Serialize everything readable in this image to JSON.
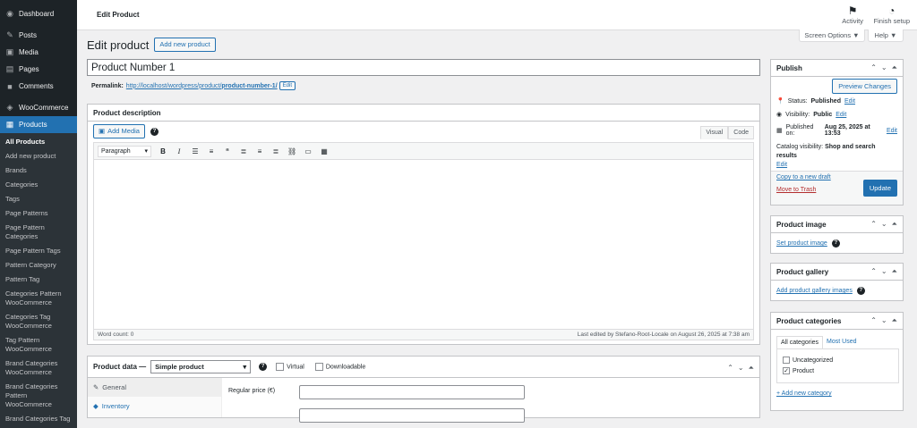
{
  "sidebar": {
    "items": [
      {
        "label": "Dashboard",
        "icon": "dashboard-icon",
        "glyph": "◉"
      },
      {
        "label": "Posts",
        "icon": "pin-icon",
        "glyph": "✎"
      },
      {
        "label": "Media",
        "icon": "media-icon",
        "glyph": "▣"
      },
      {
        "label": "Pages",
        "icon": "pages-icon",
        "glyph": "▤"
      },
      {
        "label": "Comments",
        "icon": "comments-icon",
        "glyph": "■"
      },
      {
        "label": "WooCommerce",
        "icon": "woocommerce-icon",
        "glyph": "◈"
      },
      {
        "label": "Products",
        "icon": "products-icon",
        "glyph": "▦"
      }
    ],
    "submenu": [
      "All Products",
      "Add new product",
      "Brands",
      "Categories",
      "Tags",
      "Page Patterns",
      "Page Pattern Categories",
      "Page Pattern Tags",
      "Pattern Category",
      "Pattern Tag",
      "Categories Pattern WooCommerce",
      "Categories Tag WooCommerce",
      "Tag Pattern WooCommerce",
      "Brand Categories WooCommerce",
      "Brand Categories Pattern WooCommerce",
      "Brand Categories Tag"
    ]
  },
  "topbar": {
    "title": "Edit Product",
    "activity": "Activity",
    "finish": "Finish setup",
    "screen_options": "Screen Options ▼",
    "help": "Help ▼"
  },
  "page": {
    "heading": "Edit product",
    "add_new": "Add new product",
    "product_title": "Product Number 1"
  },
  "permalink": {
    "label": "Permalink:",
    "url_base": "http://localhost/wordpress/product/",
    "slug": "product-number-1/",
    "edit": "Edit"
  },
  "description": {
    "title": "Product description",
    "add_media": "Add Media",
    "tab_visual": "Visual",
    "tab_code": "Code",
    "paragraph": "Paragraph",
    "word_count": "Word count: 0",
    "last_edited": "Last edited by Stefano-Root-Locale on August 26, 2025 at 7:38 am"
  },
  "product_data": {
    "title": "Product data —",
    "type": "Simple product",
    "virtual": "Virtual",
    "downloadable": "Downloadable",
    "tabs": [
      "General",
      "Inventory"
    ],
    "regular_price": "Regular price (€)"
  },
  "publish": {
    "title": "Publish",
    "preview": "Preview Changes",
    "status_label": "Status:",
    "status_value": "Published",
    "visibility_label": "Visibility:",
    "visibility_value": "Public",
    "published_label": "Published on:",
    "published_value": "Aug 25, 2025 at 13:53",
    "edit": "Edit",
    "catalog_label": "Catalog visibility:",
    "catalog_value": "Shop and search results",
    "copy_draft": "Copy to a new draft",
    "trash": "Move to Trash",
    "update": "Update"
  },
  "product_image": {
    "title": "Product image",
    "link": "Set product image"
  },
  "product_gallery": {
    "title": "Product gallery",
    "link": "Add product gallery images"
  },
  "product_categories": {
    "title": "Product categories",
    "tab_all": "All categories",
    "tab_used": "Most Used",
    "items": [
      {
        "label": "Uncategorized",
        "checked": false
      },
      {
        "label": "Product",
        "checked": true
      }
    ],
    "add_new": "+ Add new category"
  },
  "colors": {
    "accent": "#2271b1",
    "sidebar": "#1d2327",
    "update": "#2271b1",
    "trash": "#b32d2e"
  }
}
